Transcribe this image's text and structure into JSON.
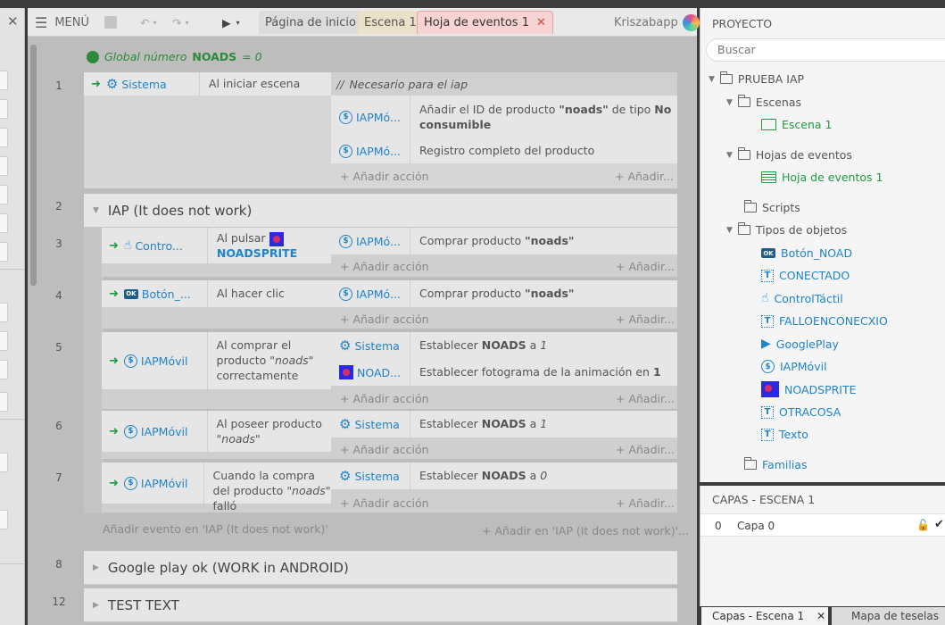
{
  "toolbar": {
    "menu": "MENÚ",
    "user": "Kriszabapp"
  },
  "tabs": [
    {
      "label": "Página de inicio"
    },
    {
      "label": "Escena 1"
    },
    {
      "label": "Hoja de eventos 1",
      "close": "✕"
    }
  ],
  "global_var": {
    "prefix": "Global número",
    "name": "NOADS",
    "suffix": "= 0"
  },
  "events": [
    {
      "num": "1",
      "cond_obj": "Sistema",
      "cond_text": "Al iniciar escena",
      "comment": "Necesario para el iap",
      "act1_obj": "IAPMó...",
      "act1_text_a": "Añadir el ID de producto",
      "act1_text_b": "\"noads\"",
      "act1_text_c": "de tipo",
      "act1_text_d": "No consumible",
      "act2_obj": "IAPMó...",
      "act2_text": "Registro completo del producto",
      "add": "Añadir acción",
      "add2": "Añadir..."
    },
    {
      "num": "2",
      "group": "IAP (It does not work)"
    },
    {
      "num": "3",
      "cond_obj": "Contro...",
      "cond_text": "Al pulsar",
      "cond_text2": "NOADSPRITE",
      "act1_obj": "IAPMó...",
      "act1_text": "Comprar producto",
      "act1_bold": "\"noads\"",
      "add": "Añadir acción",
      "add2": "Añadir..."
    },
    {
      "num": "4",
      "cond_obj": "Botón_...",
      "cond_text": "Al hacer clic",
      "act1_obj": "IAPMó...",
      "act1_text": "Comprar producto",
      "act1_bold": "\"noads\"",
      "add": "Añadir acción",
      "add2": "Añadir..."
    },
    {
      "num": "5",
      "cond_obj": "IAPMóvil",
      "cond_text_a": "Al comprar el producto",
      "cond_text_b": "\"noads\"",
      "cond_text_c": "correctamente",
      "act1_obj": "Sistema",
      "act1_text": "Establecer",
      "act1_bold": "NOADS",
      "act1_a": "a",
      "act1_val": "1",
      "act2_obj": "NOAD...",
      "act2_text": "Establecer fotograma de la animación en",
      "act2_val": "1",
      "add": "Añadir acción",
      "add2": "Añadir..."
    },
    {
      "num": "6",
      "cond_obj": "IAPMóvil",
      "cond_text_a": "Al poseer producto",
      "cond_text_b": "\"noads\"",
      "act1_obj": "Sistema",
      "act1_text": "Establecer",
      "act1_bold": "NOADS",
      "act1_a": "a",
      "act1_val": "1",
      "add": "Añadir acción",
      "add2": "Añadir..."
    },
    {
      "num": "7",
      "cond_obj": "IAPMóvil",
      "cond_text_a": "Cuando la compra del producto",
      "cond_text_b": "\"noads\"",
      "cond_text_c": "falló",
      "act1_obj": "Sistema",
      "act1_text": "Establecer",
      "act1_bold": "NOADS",
      "act1_a": "a",
      "act1_val": "0",
      "add": "Añadir acción",
      "add2": "Añadir..."
    }
  ],
  "add_event_group": "Añadir evento en 'IAP (It does not work)'",
  "add_event_group2": "+ Añadir en 'IAP (It does not work)'...",
  "groups_after": [
    {
      "num": "8",
      "title": "Google play ok (WORK in ANDROID)"
    },
    {
      "num": "12",
      "title": "TEST TEXT"
    }
  ],
  "project": {
    "title": "PROYECTO",
    "search_placeholder": "Buscar",
    "tree": [
      {
        "label": "PRUEBA IAP"
      },
      {
        "label": "Escenas"
      },
      {
        "label": "Escena 1"
      },
      {
        "label": "Hojas de eventos"
      },
      {
        "label": "Hoja de eventos 1"
      },
      {
        "label": "Scripts"
      },
      {
        "label": "Tipos de objetos"
      },
      {
        "label": "Botón_NOAD"
      },
      {
        "label": "CONECTADO"
      },
      {
        "label": "ControlTáctil"
      },
      {
        "label": "FALLOENCONECXIO"
      },
      {
        "label": "GooglePlay"
      },
      {
        "label": "IAPMóvil"
      },
      {
        "label": "NOADSPRITE"
      },
      {
        "label": "OTRACOSA"
      },
      {
        "label": "Texto"
      },
      {
        "label": "Familias"
      }
    ]
  },
  "layers": {
    "title": "CAPAS - ESCENA 1",
    "row_num": "0",
    "row_name": "Capa 0"
  },
  "bottom_tabs": [
    {
      "label": "Capas - Escena 1"
    },
    {
      "label": "Mapa de teselas"
    }
  ],
  "colors": {
    "accent_blue": "#1f84c9",
    "green": "#1d9c41",
    "tab_events": "#f8d3d3",
    "tab_scene": "#ebe1c9"
  }
}
